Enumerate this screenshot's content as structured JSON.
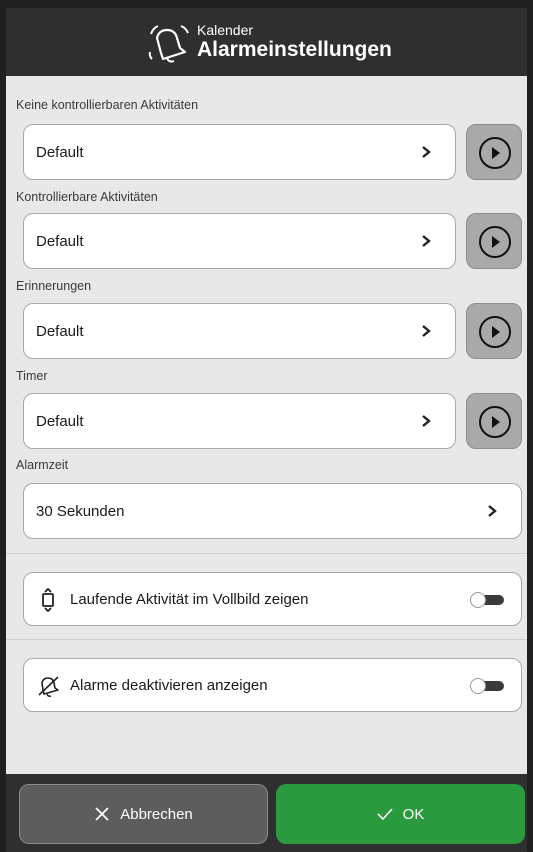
{
  "header": {
    "subtitle": "Kalender",
    "title": "Alarmeinstellungen",
    "icon": "bell-icon"
  },
  "sections": [
    {
      "label": "Keine kontrollierbaren Aktivitäten",
      "value": "Default"
    },
    {
      "label": "Kontrollierbare Aktivitäten",
      "value": "Default"
    },
    {
      "label": "Erinnerungen",
      "value": "Default"
    },
    {
      "label": "Timer",
      "value": "Default"
    }
  ],
  "alarm_time": {
    "label": "Alarmzeit",
    "value": "30 Sekunden"
  },
  "toggles": [
    {
      "label": "Laufende Aktivität im Vollbild zeigen",
      "icon": "fullscreen-icon",
      "on": false
    },
    {
      "label": "Alarme deaktivieren anzeigen",
      "icon": "bell-off-icon",
      "on": false
    }
  ],
  "footer": {
    "cancel_label": "Abbrechen",
    "ok_label": "OK"
  },
  "colors": {
    "header": "#2f2f2f",
    "background": "#e8e8e8",
    "ok": "#2a9a3e",
    "cancel": "#5d5d5d"
  }
}
